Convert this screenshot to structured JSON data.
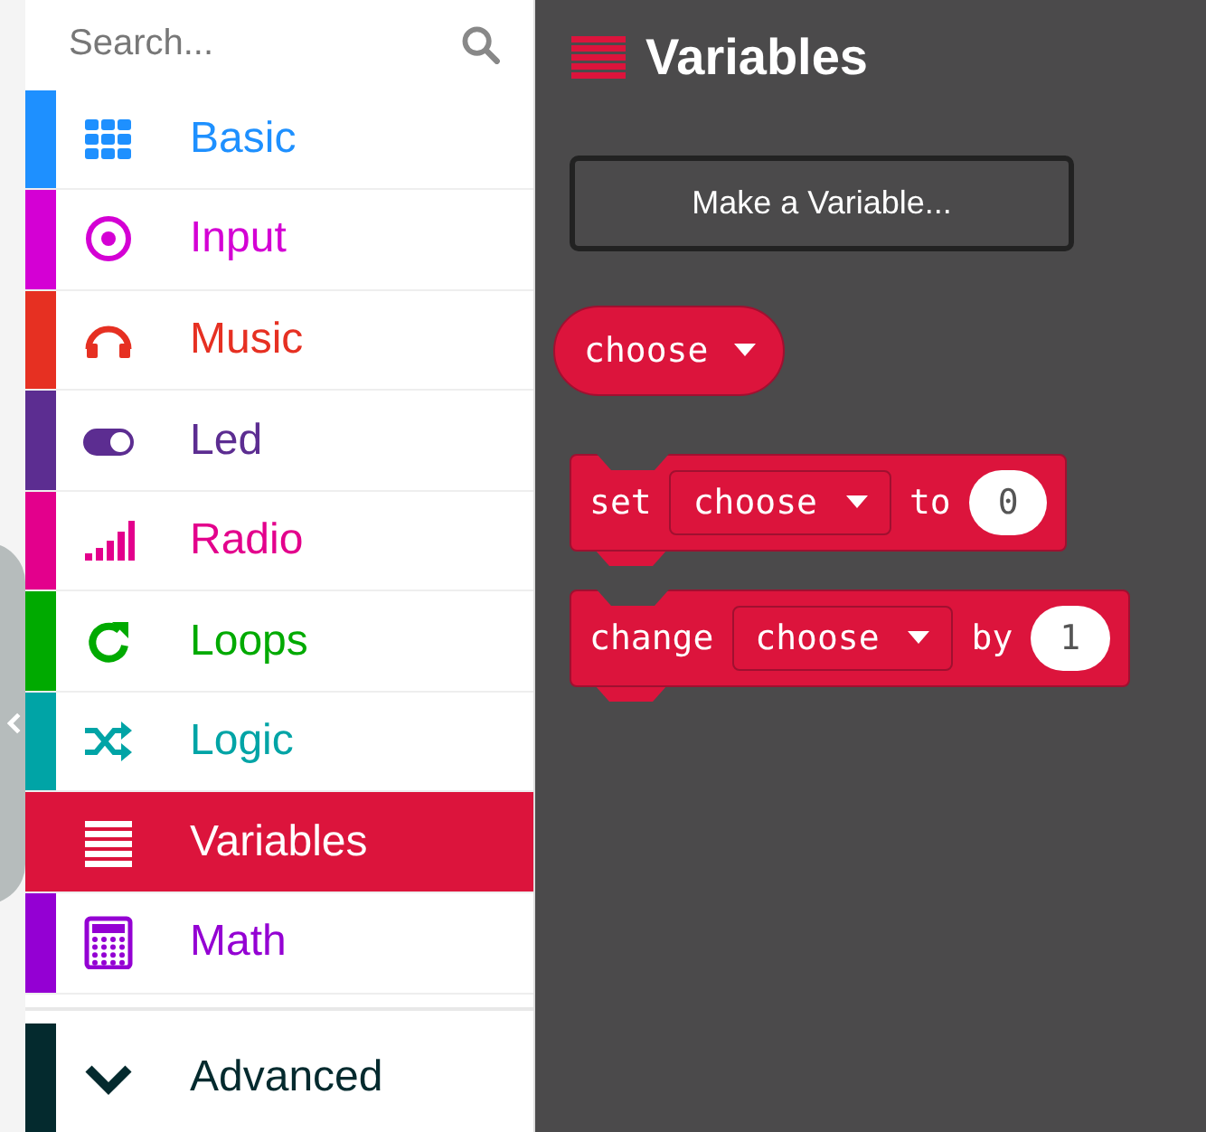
{
  "search": {
    "placeholder": "Search..."
  },
  "categories": [
    {
      "label": "Basic",
      "color": "#1e90ff",
      "selected": false
    },
    {
      "label": "Input",
      "color": "#d400d4",
      "selected": false
    },
    {
      "label": "Music",
      "color": "#e63022",
      "selected": false
    },
    {
      "label": "Led",
      "color": "#5c2d91",
      "selected": false
    },
    {
      "label": "Radio",
      "color": "#e3008c",
      "selected": false
    },
    {
      "label": "Loops",
      "color": "#00aa00",
      "selected": false
    },
    {
      "label": "Logic",
      "color": "#00a4a6",
      "selected": false
    },
    {
      "label": "Variables",
      "color": "#dc143c",
      "selected": true
    },
    {
      "label": "Math",
      "color": "#9400d3",
      "selected": false
    }
  ],
  "advanced": {
    "label": "Advanced",
    "color": "#042a2e"
  },
  "flyout": {
    "title": "Variables",
    "color": "#dc143c",
    "button": "Make a Variable...",
    "blocks": [
      {
        "kind": "reporter",
        "variable": "choose"
      },
      {
        "kind": "statement",
        "keyword": "set",
        "variable": "choose",
        "connector": "to",
        "value": "0"
      },
      {
        "kind": "statement",
        "keyword": "change",
        "variable": "choose",
        "connector": "by",
        "value": "1"
      }
    ]
  }
}
